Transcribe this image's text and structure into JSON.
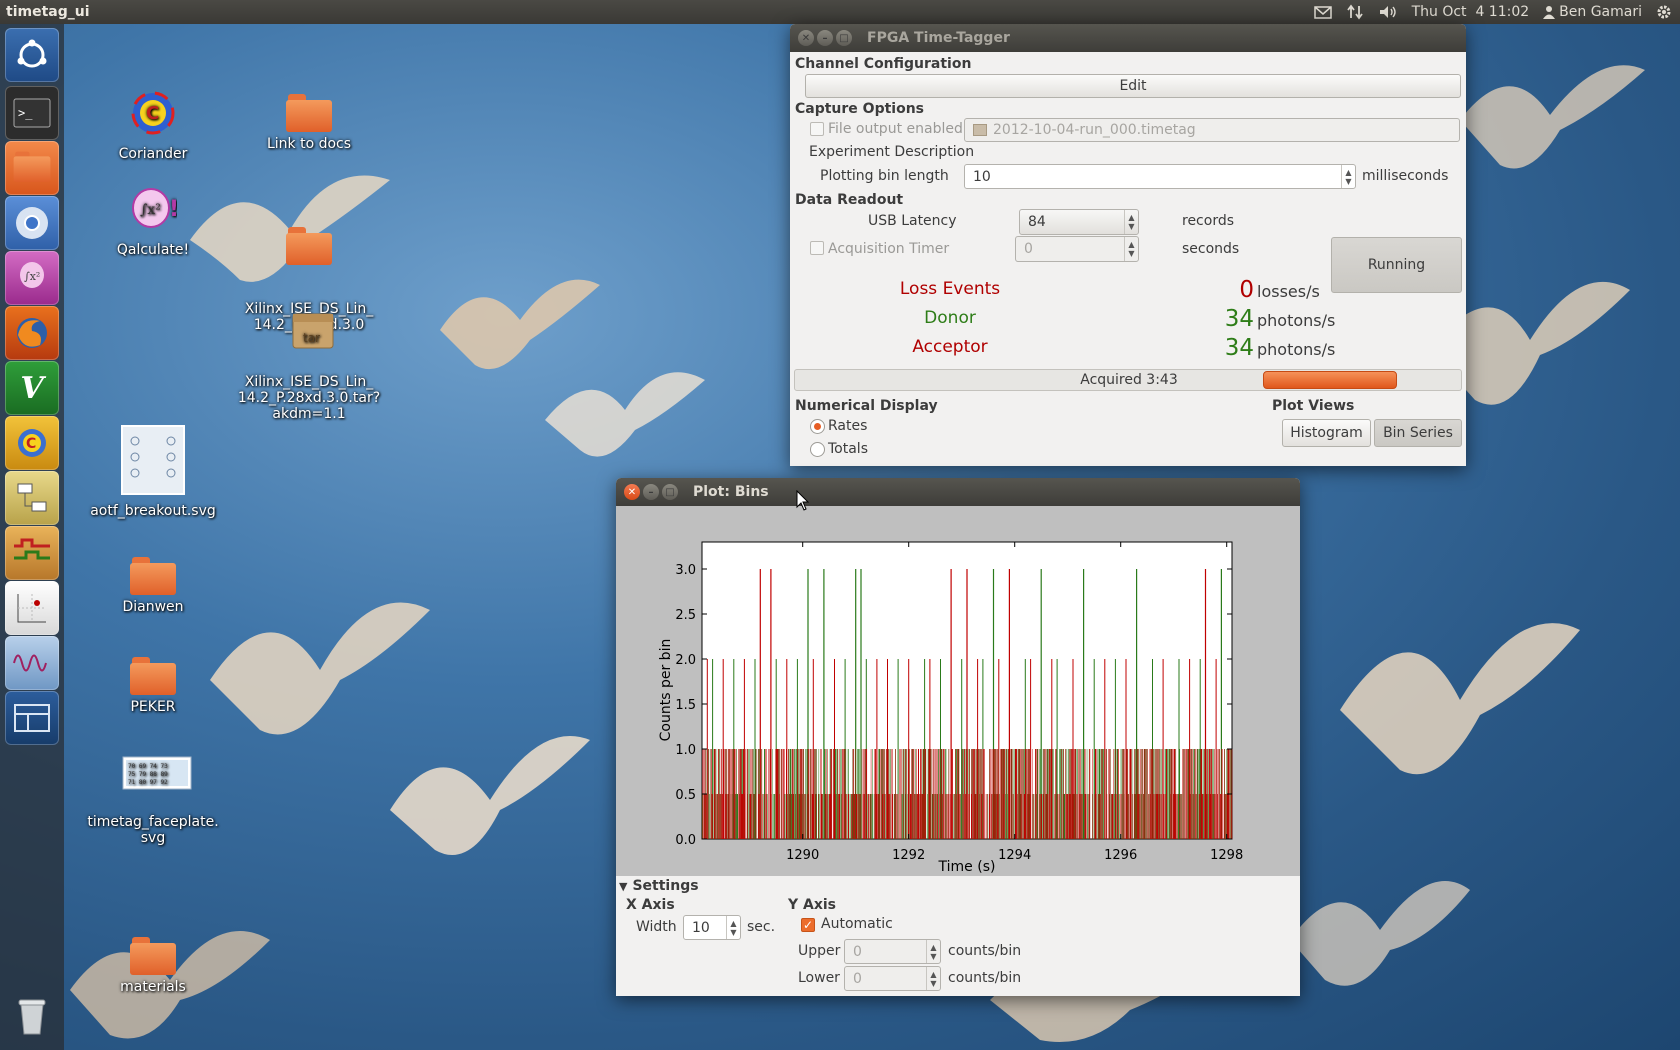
{
  "top_panel": {
    "app_title": "timetag_ui",
    "datetime": "Thu Oct  4 11:02",
    "user": "Ben Gamari",
    "indicators": [
      "mail-icon",
      "network-icon",
      "volume-icon",
      "user-icon",
      "gear-icon"
    ]
  },
  "launcher": {
    "items": [
      "ubuntu-logo-icon",
      "terminal-icon",
      "files-icon",
      "chromium-icon",
      "qalculate-icon",
      "firefox-icon",
      "vim-icon",
      "coriander-icon",
      "diagram-editor-icon",
      "timing-icon",
      "plot-app-icon",
      "signal-app-icon",
      "workspace-switcher-icon",
      "trash-icon"
    ]
  },
  "desktop_icons": [
    {
      "label": "Coriander",
      "icon": "coriander-icon"
    },
    {
      "label": "Link to docs",
      "icon": "folder-link-icon"
    },
    {
      "label": "Qalculate!",
      "icon": "qalculate-icon"
    },
    {
      "label": "Xilinx_ISE_DS_Lin_\n14.2_P.28xd.3.0",
      "icon": "folder-icon"
    },
    {
      "label": "Xilinx_ISE_DS_Lin_\n14.2_P.28xd.3.0.tar?\nakdm=1.1",
      "icon": "tar-archive-icon"
    },
    {
      "label": "aotf_breakout.svg",
      "icon": "svg-file-icon"
    },
    {
      "label": "Dianwen",
      "icon": "folder-icon"
    },
    {
      "label": "PEKER",
      "icon": "folder-icon"
    },
    {
      "label": "timetag_faceplate.\nsvg",
      "icon": "svg-file-icon"
    },
    {
      "label": "materials",
      "icon": "folder-icon"
    }
  ],
  "fpga_window": {
    "title": "FPGA Time-Tagger",
    "channel_config": {
      "heading": "Channel Configuration",
      "edit_label": "Edit"
    },
    "capture_options": {
      "heading": "Capture Options",
      "file_output_label": "File output enabled",
      "file_output_enabled": false,
      "file_name": "2012-10-04-run_000.timetag",
      "experiment_description_label": "Experiment Description",
      "plotting_bin_label": "Plotting bin length",
      "plotting_bin_value": "10",
      "plotting_bin_unit": "milliseconds"
    },
    "data_readout": {
      "heading": "Data Readout",
      "usb_latency_label": "USB Latency",
      "usb_latency_value": "84",
      "usb_latency_unit": "records",
      "acq_timer_label": "Acquisition Timer",
      "acq_timer_enabled": false,
      "acq_timer_value": "0",
      "acq_timer_unit": "seconds",
      "running_label": "Running"
    },
    "stats": [
      {
        "label": "Loss Events",
        "value": "0",
        "unit": "losses/s",
        "color": "#b00000",
        "value_color": "#b00000"
      },
      {
        "label": "Donor",
        "value": "34",
        "unit": "photons/s",
        "color": "#2e7d18",
        "value_color": "#2e7d18"
      },
      {
        "label": "Acceptor",
        "value": "34",
        "unit": "photons/s",
        "color": "#b00000",
        "value_color": "#2e7d18"
      }
    ],
    "acquired_label": "Acquired 3:43",
    "numerical_display": {
      "heading": "Numerical Display",
      "options": [
        "Rates",
        "Totals"
      ],
      "selected": "Rates"
    },
    "plot_views": {
      "heading": "Plot Views",
      "histogram_label": "Histogram",
      "bin_series_label": "Bin Series"
    }
  },
  "plot_window": {
    "title": "Plot: Bins",
    "settings": {
      "heading": "Settings",
      "x_axis": {
        "heading": "X Axis",
        "width_label": "Width",
        "width_value": "10",
        "width_unit": "sec."
      },
      "y_axis": {
        "heading": "Y Axis",
        "automatic_label": "Automatic",
        "automatic_checked": true,
        "upper_label": "Upper",
        "upper_value": "0",
        "upper_unit": "counts/bin",
        "lower_label": "Lower",
        "lower_value": "0",
        "lower_unit": "counts/bin"
      }
    }
  },
  "chart_data": {
    "type": "bar",
    "xlabel": "Time (s)",
    "ylabel": "Counts per bin",
    "xlim": [
      1288.1,
      1298.1
    ],
    "ylim": [
      0,
      3.3
    ],
    "xticks": [
      "1290",
      "1292",
      "1294",
      "1296",
      "1298"
    ],
    "xtick_values": [
      1290,
      1292,
      1294,
      1296,
      1298
    ],
    "yticks": [
      "0.0",
      "0.5",
      "1.0",
      "1.5",
      "2.0",
      "2.5",
      "3.0"
    ],
    "ytick_values": [
      0,
      0.5,
      1.0,
      1.5,
      2.0,
      2.5,
      3.0
    ],
    "bin_width": 0.01,
    "grid": false,
    "series": [
      {
        "color": "#2a7a1a",
        "baseline": "mostly 0-1 counts per bin",
        "peaks_3": [
          1290.1,
          1290.4,
          1291.0,
          1291.1,
          1293.6,
          1294.5,
          1295.3,
          1296.3,
          1297.9
        ],
        "peaks_2": [
          1288.3,
          1288.7,
          1289.1,
          1289.5,
          1289.9,
          1290.8,
          1291.2,
          1291.8,
          1292.3,
          1292.6,
          1293.0,
          1293.4,
          1294.2,
          1294.8,
          1295.5,
          1295.9,
          1296.6,
          1297.1,
          1297.5
        ]
      },
      {
        "color": "#c00000",
        "baseline": "mostly 0-1 counts per bin",
        "peaks_3": [
          1289.2,
          1289.4,
          1292.8,
          1293.1,
          1293.9,
          1297.6
        ],
        "peaks_2": [
          1288.2,
          1288.5,
          1288.9,
          1289.7,
          1290.2,
          1290.6,
          1291.4,
          1291.6,
          1292.0,
          1292.4,
          1293.3,
          1293.7,
          1294.3,
          1294.7,
          1295.1,
          1295.7,
          1296.1,
          1296.8,
          1297.3,
          1297.8
        ]
      }
    ]
  }
}
